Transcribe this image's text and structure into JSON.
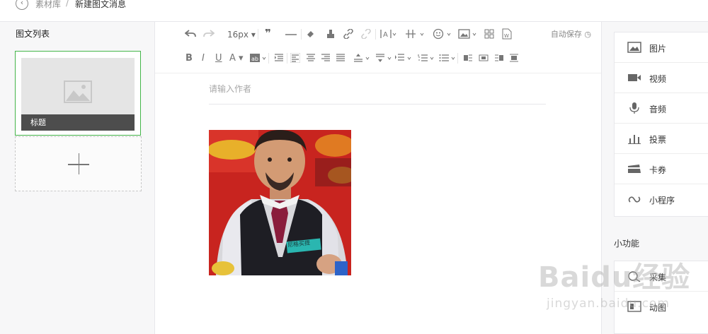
{
  "breadcrumb": {
    "library": "素材库",
    "separator": "/",
    "current": "新建图文消息"
  },
  "left_panel": {
    "title": "图文列表",
    "card_caption": "标题"
  },
  "toolbar": {
    "font_size": "16px",
    "autosave": "自动保存",
    "icons": [
      "undo-icon",
      "redo-icon",
      "font-size-select",
      "blockquote-icon",
      "horizontal-rule-icon",
      "format-brush-icon",
      "clear-format-icon",
      "link-icon",
      "unlink-icon",
      "text-spacing-icon",
      "line-spacing-icon",
      "emoji-icon",
      "image-insert-icon",
      "template-icon",
      "word-import-icon",
      "bold-icon",
      "italic-icon",
      "underline-icon",
      "font-color-icon",
      "background-color-icon",
      "indent-icon",
      "align-left-icon",
      "align-center-icon",
      "align-right-icon",
      "justify-icon",
      "row-spacing-top-icon",
      "row-spacing-bottom-icon",
      "letter-spacing-icon",
      "ordered-list-icon",
      "unordered-list-icon",
      "float-left-icon",
      "float-none-icon",
      "float-right-icon",
      "float-center-icon"
    ]
  },
  "editor": {
    "author_placeholder": "请输入作者",
    "photo_badge": "尼格买提"
  },
  "right_panel": {
    "media_items": [
      "图片",
      "视频",
      "音频",
      "投票",
      "卡券",
      "小程序"
    ],
    "mini_title": "小功能",
    "mini_items": [
      "采集",
      "动图"
    ]
  },
  "watermark": {
    "main": "Baidu经验",
    "sub": "jingyan.baidu.com"
  },
  "colors": {
    "accent": "#44b549",
    "caption_bg": "#4d4d4d",
    "panel_bg": "#f7f7f8"
  }
}
